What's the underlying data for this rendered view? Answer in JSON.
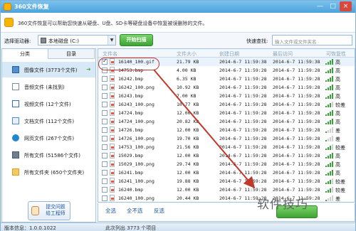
{
  "window": {
    "title": "360文件恢复",
    "min_symbol": "—",
    "max_symbol": "□",
    "close_symbol": "×"
  },
  "info": {
    "text": "360文件恢复可以帮助您快速从硬盘、U盘、SD卡等硬盘设备中恢复被误删除的文件。"
  },
  "toolbar": {
    "drive_label": "选择驱动器:",
    "drive_value": "本地磁盘 (C:)",
    "drive_arrow": "▼",
    "scan_button": "开始扫描",
    "quick_label": "快速查找:",
    "quick_placeholder": "输入文件或文件夹名"
  },
  "sidebar": {
    "tabs": [
      "分类",
      "目录"
    ],
    "categories": [
      {
        "label": "图像文件 (3773个文件)",
        "icon": "image-icon",
        "selected": true,
        "go": "➜"
      },
      {
        "label": "音频文件 (未找到)",
        "icon": "audio-icon"
      },
      {
        "label": "视频文件 (12个文件)",
        "icon": "video-icon"
      },
      {
        "label": "文档文件 (112个文件)",
        "icon": "document-icon"
      },
      {
        "label": "网页文件 (267个文件)",
        "icon": "web-icon"
      },
      {
        "label": "所有文件 (51586个文件)",
        "icon": "all-files-icon"
      },
      {
        "label": "所有文件夹 (650个文件夹)",
        "icon": "folder-icon"
      }
    ],
    "feedback_line1": "提交问题",
    "feedback_line2": "给工程师"
  },
  "filelist": {
    "headers": {
      "name": "文件名",
      "size": "文件大小",
      "created": "创建日期",
      "accessed": "最后访问",
      "recoverable": "可恢复性"
    },
    "rows": [
      {
        "name": "16140_100.gif",
        "size": "21.79 KB",
        "created": "2014-6-7 11:59:38",
        "accessed": "2014-6-7 11:59:38",
        "level": "高",
        "bars": 4,
        "checked": true,
        "highlight": true
      },
      {
        "name": "14753.bmp",
        "size": "4.00 KB",
        "created": "2014-6-7 11:59:28",
        "accessed": "2014-6-7 11:59:28",
        "level": "高",
        "bars": 4
      },
      {
        "name": "16242.bmp",
        "size": "6.35 KB",
        "created": "2014-6-7 11:59:28",
        "accessed": "2014-6-7 11:59:28",
        "level": "高",
        "bars": 4
      },
      {
        "name": "16242_100.png",
        "size": "10.92 KB",
        "created": "2014-6-7 11:59:28",
        "accessed": "2014-6-7 11:59:28",
        "level": "高",
        "bars": 4
      },
      {
        "name": "16243.bmp",
        "size": "7.00 KB",
        "created": "2014-6-7 11:59:28",
        "accessed": "2014-6-7 11:59:28",
        "level": "高",
        "bars": 4
      },
      {
        "name": "16243_100.png",
        "size": "10.77 KB",
        "created": "2014-6-7 11:59:28",
        "accessed": "2014-6-7 11:59:28",
        "level": "较差",
        "bars": 3
      },
      {
        "name": "14724.bmp",
        "size": "12.00 KB",
        "created": "2014-6-7 11:59:28",
        "accessed": "2014-6-7 11:59:28",
        "level": "高",
        "bars": 4
      },
      {
        "name": "14724_100.png",
        "size": "20.82 KB",
        "created": "2014-6-7 11:59:28",
        "accessed": "2014-6-7 11:59:28",
        "level": "高",
        "bars": 4
      },
      {
        "name": "14726.bmp",
        "size": "12.00 KB",
        "created": "2014-6-7 11:59:28",
        "accessed": "2014-6-7 11:59:28",
        "level": "差",
        "bars": 1
      },
      {
        "name": "14726_100.png",
        "size": "19.70 KB",
        "created": "2014-6-7 11:59:28",
        "accessed": "2014-6-7 11:59:28",
        "level": "差",
        "bars": 1
      },
      {
        "name": "14753_100.png",
        "size": "21.56 KB",
        "created": "2014-6-7 11:59:28",
        "accessed": "2014-6-7 11:59:28",
        "level": "较差",
        "bars": 3
      },
      {
        "name": "15029.bmp",
        "size": "12.00 KB",
        "created": "2014-6-7 11:59:28",
        "accessed": "2014-6-7 11:59:28",
        "level": "高",
        "bars": 4
      },
      {
        "name": "15029_100.png",
        "size": "29.74 KB",
        "created": "2014-6-7 11:59:28",
        "accessed": "2014-6-7 11:59:28",
        "level": "高",
        "bars": 4
      },
      {
        "name": "16241.bmp",
        "size": "12.00 KB",
        "created": "2014-6-7 11:59:28",
        "accessed": "2014-6-7 11:59:28",
        "level": "高",
        "bars": 4
      },
      {
        "name": "16241_100.png",
        "size": "19.88 KB",
        "created": "2014-6-7 11:59:28",
        "accessed": "2014-6-7 11:59:28",
        "level": "较差",
        "bars": 3
      },
      {
        "name": "16240.bmp",
        "size": "12.00 KB",
        "created": "2014-6-7 11:59:28",
        "accessed": "2014-6-7 11:59:28",
        "level": "较差",
        "bars": 3
      },
      {
        "name": "16240_100.png",
        "size": "20.44 KB",
        "created": "2014-6-7 11:59:28",
        "accessed": "2014-6-7 11:59:28",
        "level": "差",
        "bars": 1
      }
    ]
  },
  "actions": {
    "select_all": "全选",
    "select_none": "全不选",
    "invert": "反选"
  },
  "status": {
    "version": "版本信息：1.0.0.1022",
    "count": "此次列出 3773 个项目"
  },
  "watermark": "软件技巧",
  "colors": {
    "accent": "#4aa2db",
    "scan_green": "#3ea332",
    "annotation_red": "#c0392b"
  }
}
